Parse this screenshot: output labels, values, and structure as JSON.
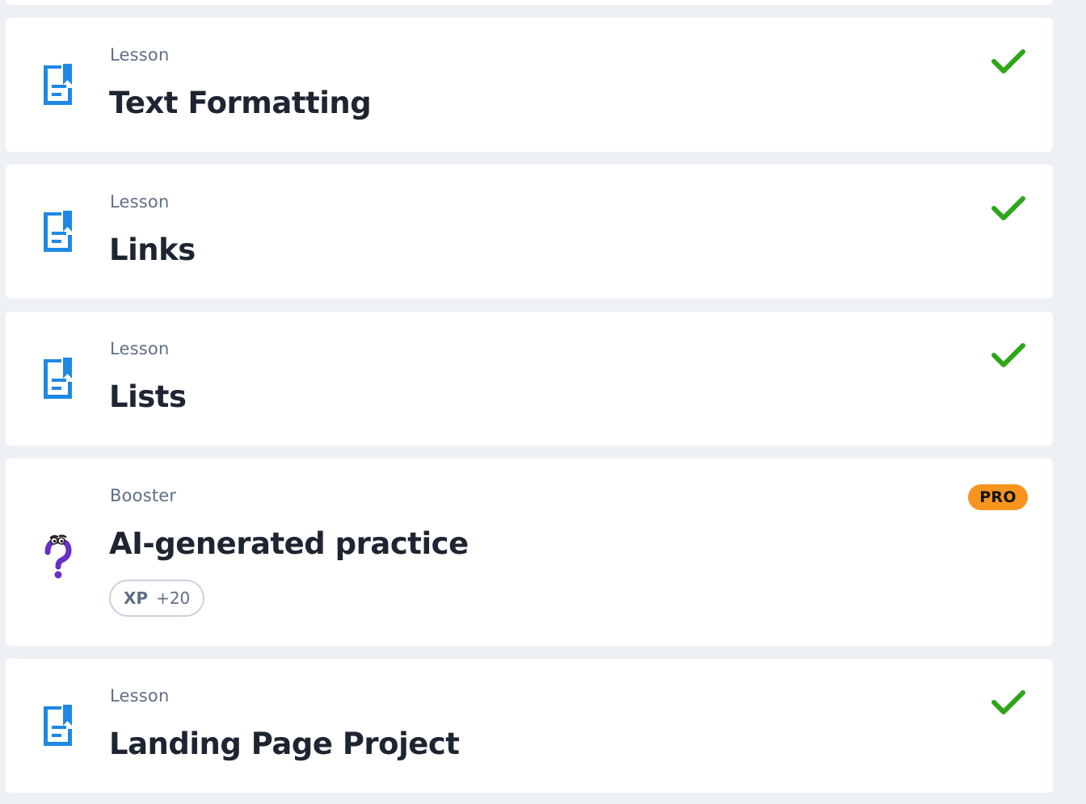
{
  "items": [
    {
      "type": "Lesson",
      "title": "Text Formatting",
      "icon": "lesson-document-icon",
      "status": "completed"
    },
    {
      "type": "Lesson",
      "title": "Links",
      "icon": "lesson-document-icon",
      "status": "completed"
    },
    {
      "type": "Lesson",
      "title": "Lists",
      "icon": "lesson-document-icon",
      "status": "completed"
    },
    {
      "type": "Booster",
      "title": "AI-generated practice",
      "icon": "question-mark-character-icon",
      "badge": "PRO",
      "xp_label": "XP",
      "xp_value": "+20"
    },
    {
      "type": "Lesson",
      "title": "Landing Page Project",
      "icon": "lesson-document-icon",
      "status": "completed"
    }
  ],
  "colors": {
    "lesson_icon": "#1e88e5",
    "check": "#2fa51a",
    "pro_badge": "#f7941d",
    "booster_icon": "#6a2fc7",
    "background": "#edf0f4"
  }
}
